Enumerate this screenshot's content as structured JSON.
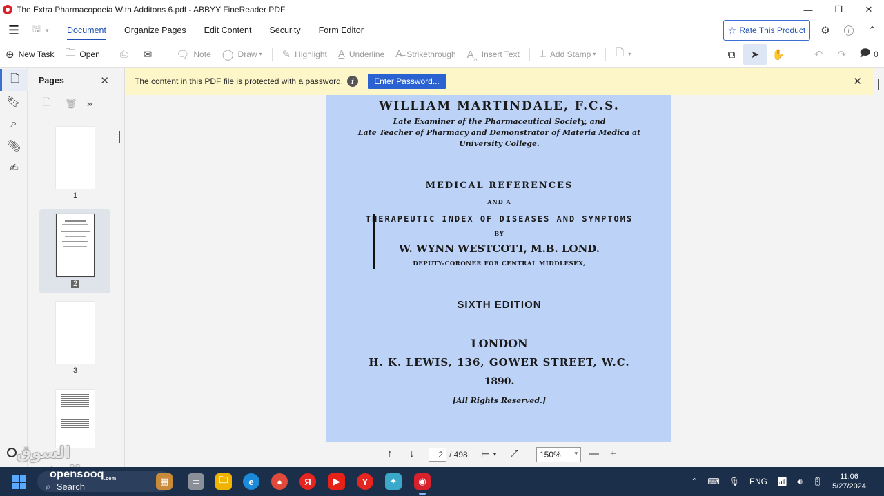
{
  "window": {
    "title": "The Extra Pharmacopoeia With Additons 6.pdf - ABBYY FineReader PDF",
    "minimize": "—",
    "maximize": "❐",
    "close": "✕"
  },
  "menu": {
    "tabs": [
      "Document",
      "Organize Pages",
      "Edit Content",
      "Security",
      "Form Editor"
    ],
    "active_tab": "Document",
    "rate_label": "Rate This Product"
  },
  "toolbar": {
    "new_task": "New Task",
    "open": "Open",
    "note": "Note",
    "draw": "Draw",
    "highlight": "Highlight",
    "underline": "Underline",
    "strikethrough": "Strikethrough",
    "insert_text": "Insert Text",
    "add_stamp": "Add Stamp",
    "comments_count": "0"
  },
  "pages_panel": {
    "title": "Pages",
    "thumbs": [
      "1",
      "2",
      "3"
    ],
    "selected": "2"
  },
  "notice": {
    "text": "The content in this PDF file is protected with a password.",
    "button": "Enter Password..."
  },
  "document": {
    "line1": "WILLIAM MARTINDALE, F.C.S.",
    "line2": "Late Examiner of the Pharmaceutical Society, and",
    "line3": "Late Teacher of Pharmacy and Demonstrator of Materia Medica at",
    "line4": "University College.",
    "line5": "MEDICAL REFERENCES",
    "line6": "AND A",
    "line7": "THERAPEUTIC INDEX OF DISEASES AND SYMPTOMS",
    "line8": "BY",
    "line9": "W. WYNN WESTCOTT, M.B. LOND.",
    "line10": "DEPUTY-CORONER FOR CENTRAL MIDDLESEX,",
    "line11": "SIXTH EDITION",
    "line12": "LONDON",
    "line13": "H. K. LEWIS, 136, GOWER STREET, W.C.",
    "line14": "1890.",
    "line15": "[All Rights Reserved.]"
  },
  "navigation": {
    "current_page": "2",
    "total": "/ 498",
    "zoom": "150%"
  },
  "watermark": {
    "text": "السوق المفتوح",
    "logo": "opensooq",
    "logo_suffix": ".com"
  },
  "taskbar": {
    "search": "Search",
    "lang": "ENG",
    "time": "11:06",
    "date": "5/27/2024"
  }
}
